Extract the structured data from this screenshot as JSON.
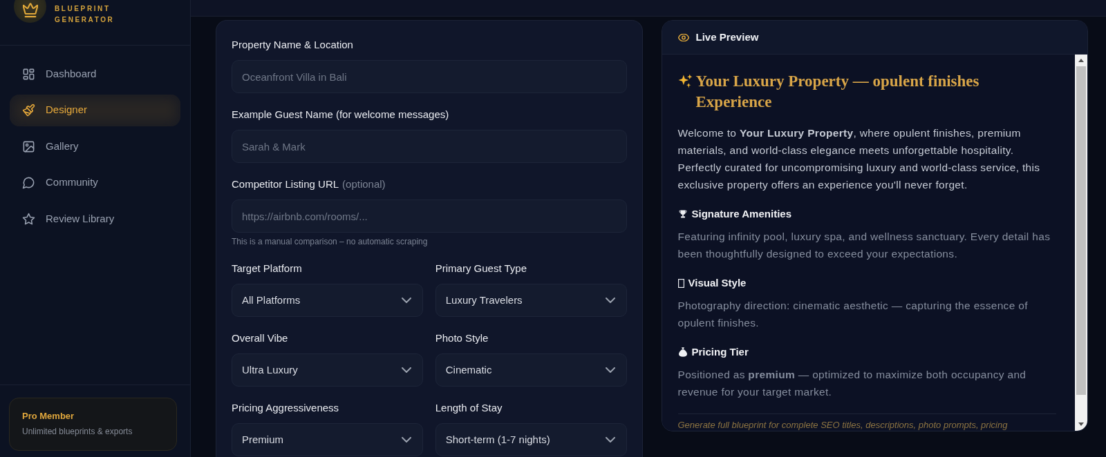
{
  "sidebar": {
    "tagline": "BLUEPRINT GENERATOR",
    "nav": [
      {
        "label": "Dashboard",
        "selected": false
      },
      {
        "label": "Designer",
        "selected": true
      },
      {
        "label": "Gallery",
        "selected": false
      },
      {
        "label": "Community",
        "selected": false
      },
      {
        "label": "Review Library",
        "selected": false
      }
    ],
    "membership": {
      "title": "Pro Member",
      "text": "Unlimited blueprints & exports"
    }
  },
  "form": {
    "fields": [
      {
        "label": "Property Name & Location",
        "placeholder": "Oceanfront Villa in Bali"
      },
      {
        "label": "Example Guest Name (for welcome messages)",
        "placeholder": "Sarah & Mark"
      },
      {
        "label": "Competitor Listing URL",
        "note": "(optional)",
        "placeholder": "https://airbnb.com/rooms/...",
        "help": "This is a manual comparison – no automatic scraping"
      }
    ],
    "selects": [
      {
        "label": "Target Platform",
        "value": "All Platforms"
      },
      {
        "label": "Primary Guest Type",
        "value": "Luxury Travelers"
      },
      {
        "label": "Overall Vibe",
        "value": "Ultra Luxury"
      },
      {
        "label": "Photo Style",
        "value": "Cinematic"
      },
      {
        "label": "Pricing Aggressiveness",
        "value": "Premium"
      },
      {
        "label": "Length of Stay",
        "value": "Short-term (1-7 nights)"
      }
    ]
  },
  "preview": {
    "title": "Live Preview",
    "heading": "Your Luxury Property — opulent finishes Experience",
    "intro": "Welcome to **Your Luxury Property**, where opulent finishes, premium materials, and world-class elegance meets unforgettable hospitality. Perfectly curated for uncompromising luxury and world-class service, this exclusive property offers an experience you'll never forget.",
    "sections": [
      {
        "title": "Signature Amenities",
        "text": "Featuring infinity pool, luxury spa, and wellness sanctuary. Every detail has been thoughtfully designed to exceed your expectations."
      },
      {
        "title": "Visual Style",
        "text": "Photography direction: cinematic aesthetic — capturing the essence of opulent finishes."
      },
      {
        "title": "Pricing Tier",
        "text": "Positioned as **premium** — optimized to maximize both occupancy and revenue for your target market."
      }
    ],
    "note": "Generate full blueprint for complete SEO titles, descriptions, photo prompts, pricing"
  }
}
